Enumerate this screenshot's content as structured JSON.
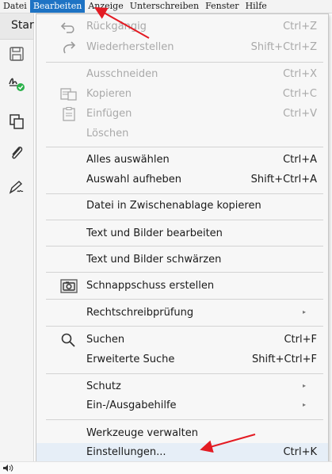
{
  "menubar": {
    "items": [
      "Datei",
      "Bearbeiten",
      "Anzeige",
      "Unterschreiben",
      "Fenster",
      "Hilfe"
    ]
  },
  "left_toolbar": {
    "tab_label": "Star",
    "icons": [
      "save-icon",
      "sign-icon",
      "copy-pages-icon",
      "paperclip-icon",
      "signature-pen-icon"
    ]
  },
  "edit_menu": {
    "items": {
      "undo": {
        "label": "Rückgängig",
        "shortcut": "Ctrl+Z"
      },
      "redo": {
        "label": "Wiederherstellen",
        "shortcut": "Shift+Ctrl+Z"
      },
      "cut": {
        "label": "Ausschneiden",
        "shortcut": "Ctrl+X"
      },
      "copy": {
        "label": "Kopieren",
        "shortcut": "Ctrl+C"
      },
      "paste": {
        "label": "Einfügen",
        "shortcut": "Ctrl+V"
      },
      "delete": {
        "label": "Löschen"
      },
      "select_all": {
        "label": "Alles auswählen",
        "shortcut": "Ctrl+A"
      },
      "deselect": {
        "label": "Auswahl aufheben",
        "shortcut": "Shift+Ctrl+A"
      },
      "copy_file": {
        "label": "Datei in Zwischenablage kopieren"
      },
      "edit_text": {
        "label": "Text und Bilder bearbeiten"
      },
      "redact": {
        "label": "Text und Bilder schwärzen"
      },
      "snapshot": {
        "label": "Schnappschuss erstellen"
      },
      "spellcheck": {
        "label": "Rechtschreibprüfung"
      },
      "search": {
        "label": "Suchen",
        "shortcut": "Ctrl+F"
      },
      "adv_search": {
        "label": "Erweiterte Suche",
        "shortcut": "Shift+Ctrl+F"
      },
      "protection": {
        "label": "Schutz"
      },
      "accessibility": {
        "label": "Ein-/Ausgabehilfe"
      },
      "manage_tools": {
        "label": "Werkzeuge verwalten"
      },
      "preferences": {
        "label": "Einstellungen...",
        "shortcut": "Ctrl+K"
      }
    }
  },
  "colors": {
    "menu_active": "#1e73c4",
    "annotation_arrow": "#e31b23",
    "accent_green": "#2bb14a"
  }
}
